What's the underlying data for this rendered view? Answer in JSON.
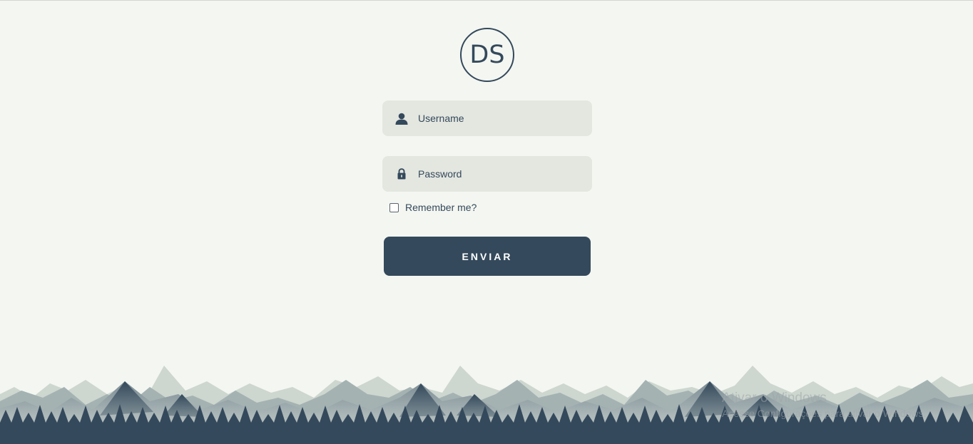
{
  "logo": {
    "text": "DS"
  },
  "form": {
    "username_placeholder": "Username",
    "password_placeholder": "Password",
    "remember_label": "Remember me?",
    "remember_checked": false,
    "submit_label": "ENVIAR"
  },
  "watermark": {
    "line1": "Ativar o Windows",
    "line2": "Acesse Configurações para ativar o Windows."
  },
  "colors": {
    "background": "#f4f6f1",
    "primary": "#34495b",
    "field_bg": "#e4e6e0"
  },
  "icons": {
    "username": "user-icon",
    "password": "lock-icon"
  }
}
